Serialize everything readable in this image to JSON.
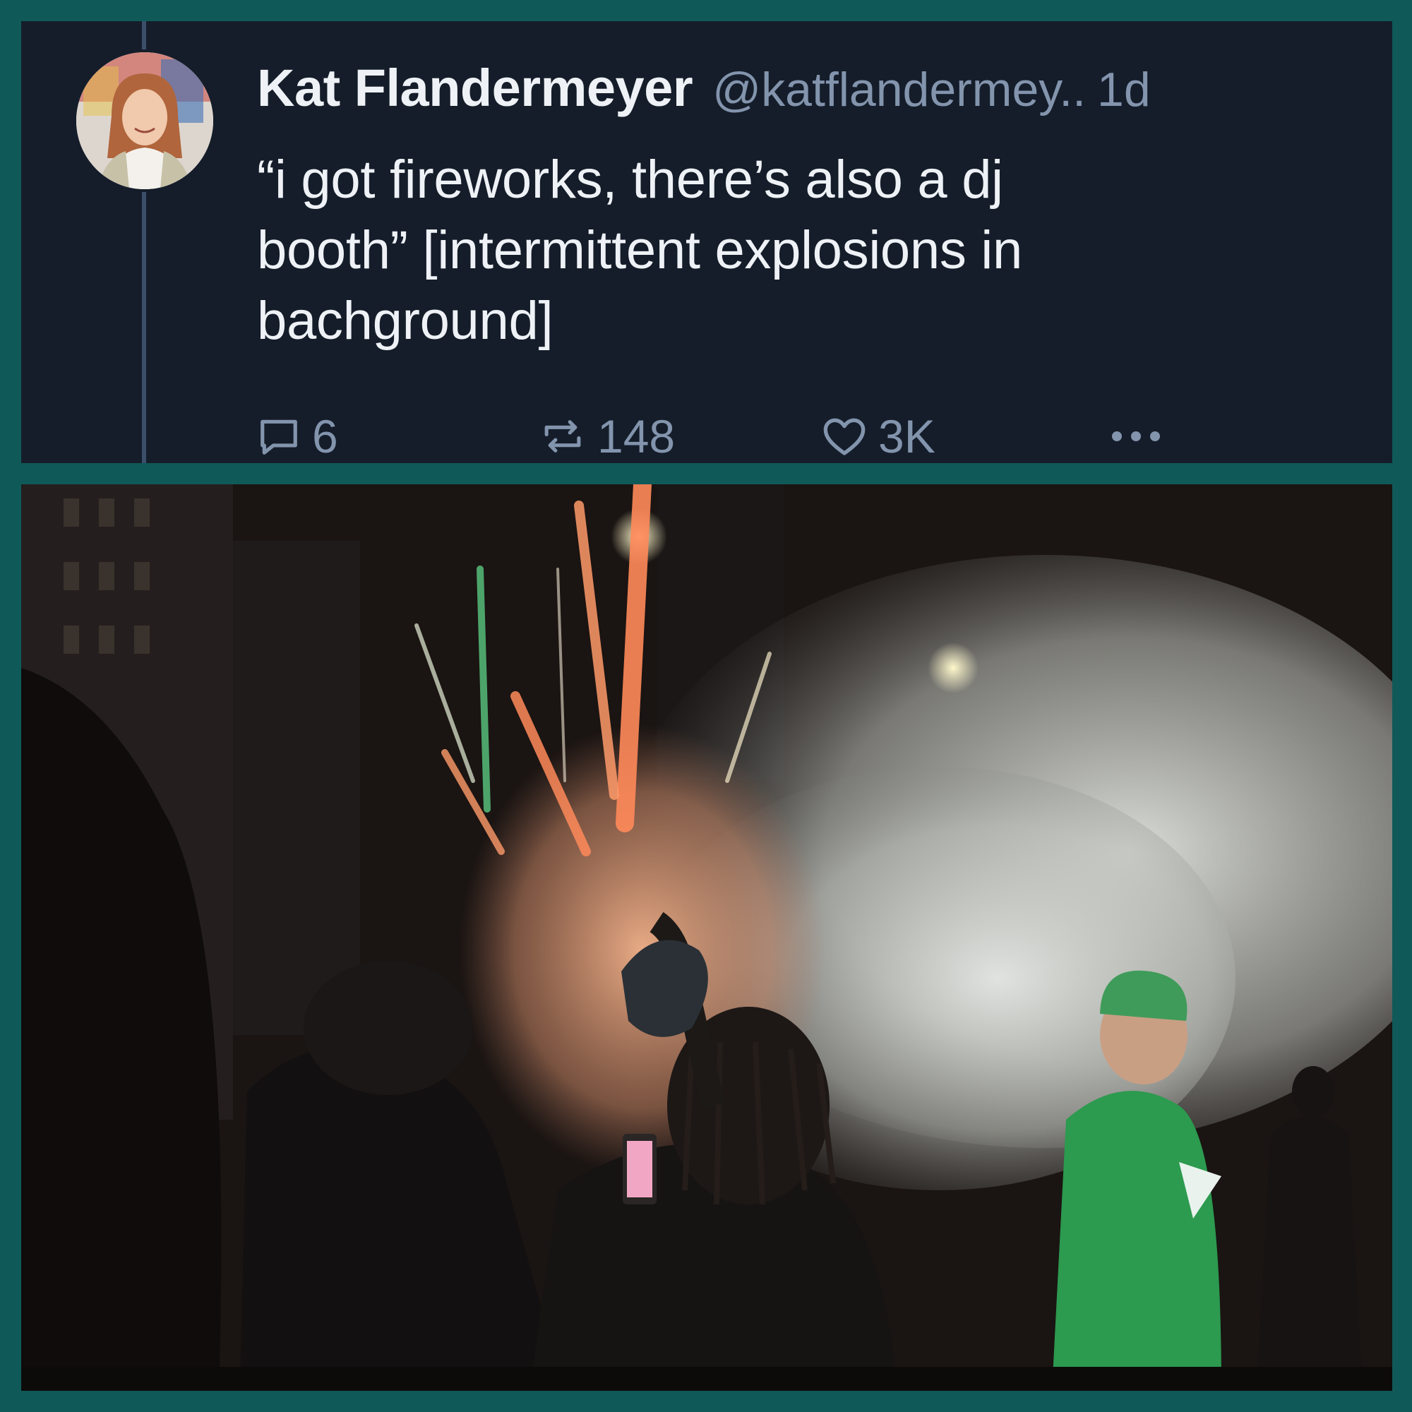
{
  "post": {
    "author_name": "Kat Flandermeyer",
    "author_handle": "@katflandermey..",
    "timestamp": "1d",
    "text": "“i got fireworks, there’s also a dj\nbooth” [intermittent explosions in\nbachground]",
    "avatar_icon": "profile-photo",
    "actions": {
      "reply_icon": "reply-icon",
      "reply_count": "6",
      "repost_icon": "repost-icon",
      "repost_count": "148",
      "like_icon": "heart-icon",
      "like_count": "3K",
      "more_icon": "more-icon",
      "more_label": "•••"
    }
  },
  "media": {
    "type": "photo",
    "subject": "night street crowd with fireworks and smoke"
  },
  "colors": {
    "frame": "#0f5a59",
    "post_background": "#151d2a",
    "primary_text": "#eef2f6",
    "secondary_text": "#8394ad",
    "thread_line": "#3b4f6b"
  }
}
